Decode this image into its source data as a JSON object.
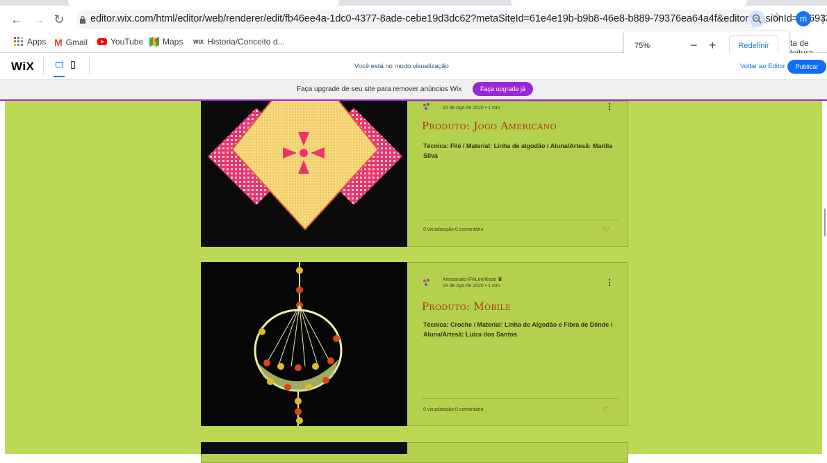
{
  "browser": {
    "url": "editor.wix.com/html/editor/web/renderer/edit/fb46ee4a-1dc0-4377-8ade-cebe19d3dc62?metaSiteId=61e4e19b-b9b8-46e8-b889-79376ea64a4f&editorSessionId=666933d...",
    "avatar_letter": "m",
    "bookmarks": [
      "Apps",
      "Gmail",
      "YouTube",
      "Maps",
      "Historia/Conceito d..."
    ],
    "reading_list_fragment": "ta de leitura"
  },
  "zoom_popup": {
    "value": "75%",
    "minus": "−",
    "plus": "+",
    "reset_label": "Redefinir"
  },
  "wix_bar": {
    "logo": "WiX",
    "preview_text": "Você está no modo visualização",
    "back_to_editor": "Voltar ao Editor",
    "publish": "Publicar"
  },
  "upgrade_banner": {
    "text": "Faça upgrade de seu site para remover anúncios Wix",
    "button": "Faça upgrade já"
  },
  "posts": [
    {
      "date": "15 de Ago de 2020 • 1 min",
      "title": "Produto: Jogo Americano",
      "description": "Técnica: Filé / Material: Linha de algodão / Aluna/Artesã: Marilia Silva",
      "stats": "0 visualização   0 comentário",
      "colors": {
        "accent": "#e8356e",
        "base": "#f2d06b"
      }
    },
    {
      "author": "Artesanato-IFALemRede",
      "date": "15 de Ago de 2020 • 1 min",
      "title": "Produto: Móbile",
      "description": "Técnica: Croche / Material: Linha de Algodão e Fibra de Dênde / Aluna/Artesã: Luiza dos Santos",
      "stats": "0 visualização   0 comentário"
    }
  ],
  "colors": {
    "page_bg": "#bcd956",
    "card_bg": "#b4d04f",
    "title": "#b0301c",
    "wix_blue": "#116dff",
    "upgrade_purple": "#9a27d5"
  }
}
